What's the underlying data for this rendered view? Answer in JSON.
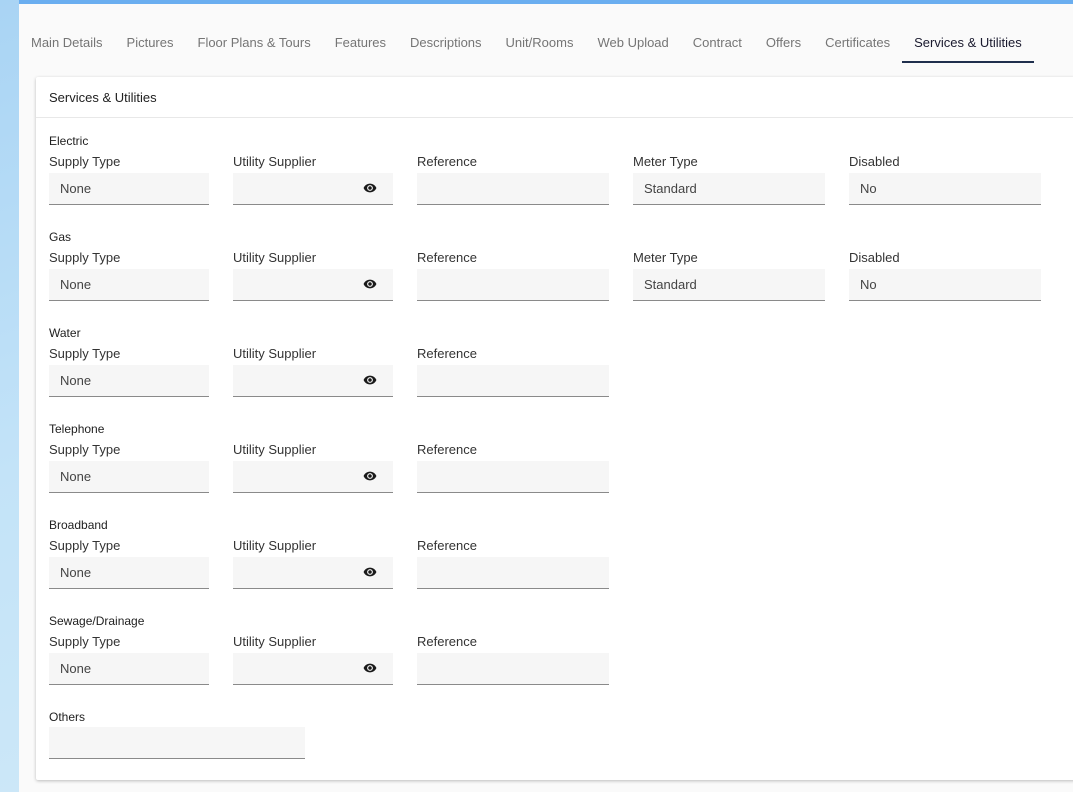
{
  "tabs": [
    {
      "label": "Main Details"
    },
    {
      "label": "Pictures"
    },
    {
      "label": "Floor Plans & Tours"
    },
    {
      "label": "Features"
    },
    {
      "label": "Descriptions"
    },
    {
      "label": "Unit/Rooms"
    },
    {
      "label": "Web Upload"
    },
    {
      "label": "Contract"
    },
    {
      "label": "Offers"
    },
    {
      "label": "Certificates"
    },
    {
      "label": "Services & Utilities"
    }
  ],
  "active_tab": "Services & Utilities",
  "card_title": "Services & Utilities",
  "labels": {
    "supply_type": "Supply Type",
    "utility_supplier": "Utility Supplier",
    "reference": "Reference",
    "meter_type": "Meter Type",
    "disabled": "Disabled"
  },
  "services": [
    {
      "name": "Electric",
      "supply_type": "None",
      "utility_supplier": "",
      "reference": "",
      "meter_type": "Standard",
      "disabled": "No"
    },
    {
      "name": "Gas",
      "supply_type": "None",
      "utility_supplier": "",
      "reference": "",
      "meter_type": "Standard",
      "disabled": "No"
    },
    {
      "name": "Water",
      "supply_type": "None",
      "utility_supplier": "",
      "reference": ""
    },
    {
      "name": "Telephone",
      "supply_type": "None",
      "utility_supplier": "",
      "reference": ""
    },
    {
      "name": "Broadband",
      "supply_type": "None",
      "utility_supplier": "",
      "reference": ""
    },
    {
      "name": "Sewage/Drainage",
      "supply_type": "None",
      "utility_supplier": "",
      "reference": ""
    }
  ],
  "others": {
    "label": "Others",
    "value": ""
  },
  "icons": {
    "supplier_view": "eye-icon"
  },
  "colors": {
    "active_tab_underline": "#1f2f4d",
    "top_bar": "#6aaef0"
  }
}
